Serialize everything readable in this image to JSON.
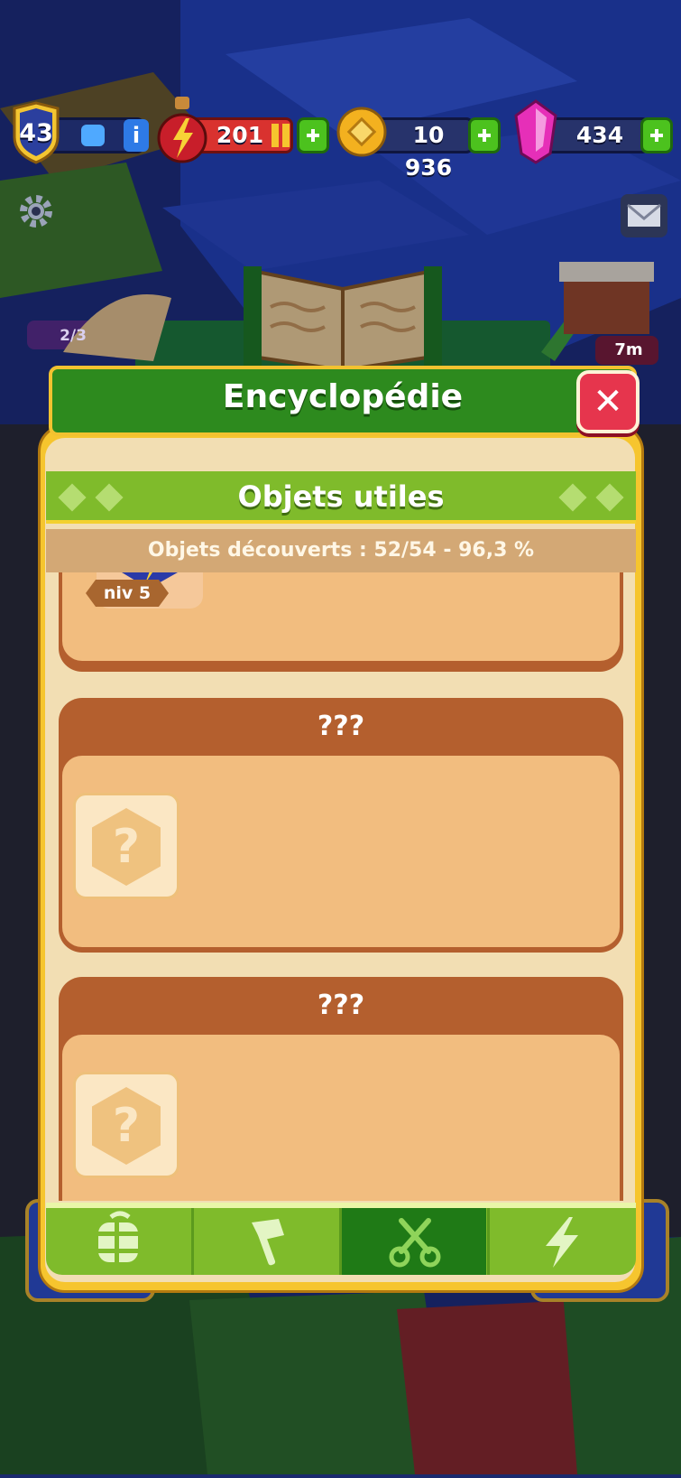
{
  "hud": {
    "level": "43",
    "energy": "201",
    "coins": "10 936",
    "gems": "434",
    "info_label": "i"
  },
  "background": {
    "left_badge": "2/3",
    "right_timer": "7m"
  },
  "modal": {
    "title": "Encyclopédie",
    "close_symbol": "✕",
    "section_title": "Objets utiles",
    "discovered": "Objets découverts : 52/54 - 96,3 %",
    "items": [
      {
        "level_label": "niv 5"
      },
      {
        "title": "???",
        "placeholder": "?"
      },
      {
        "title": "???",
        "placeholder": "?"
      }
    ],
    "tabs": [
      {
        "icon": "barrel-icon",
        "active": false
      },
      {
        "icon": "axe-icon",
        "active": false
      },
      {
        "icon": "scissors-icon",
        "active": true
      },
      {
        "icon": "lightning-icon",
        "active": false
      }
    ]
  },
  "colors": {
    "modal_gold": "#f6c52e",
    "banner_green": "#2d8a1e",
    "section_green": "#7fbb2b",
    "card_brown": "#b45f2e",
    "card_body": "#f2bd7f",
    "close_red": "#e6354d"
  }
}
